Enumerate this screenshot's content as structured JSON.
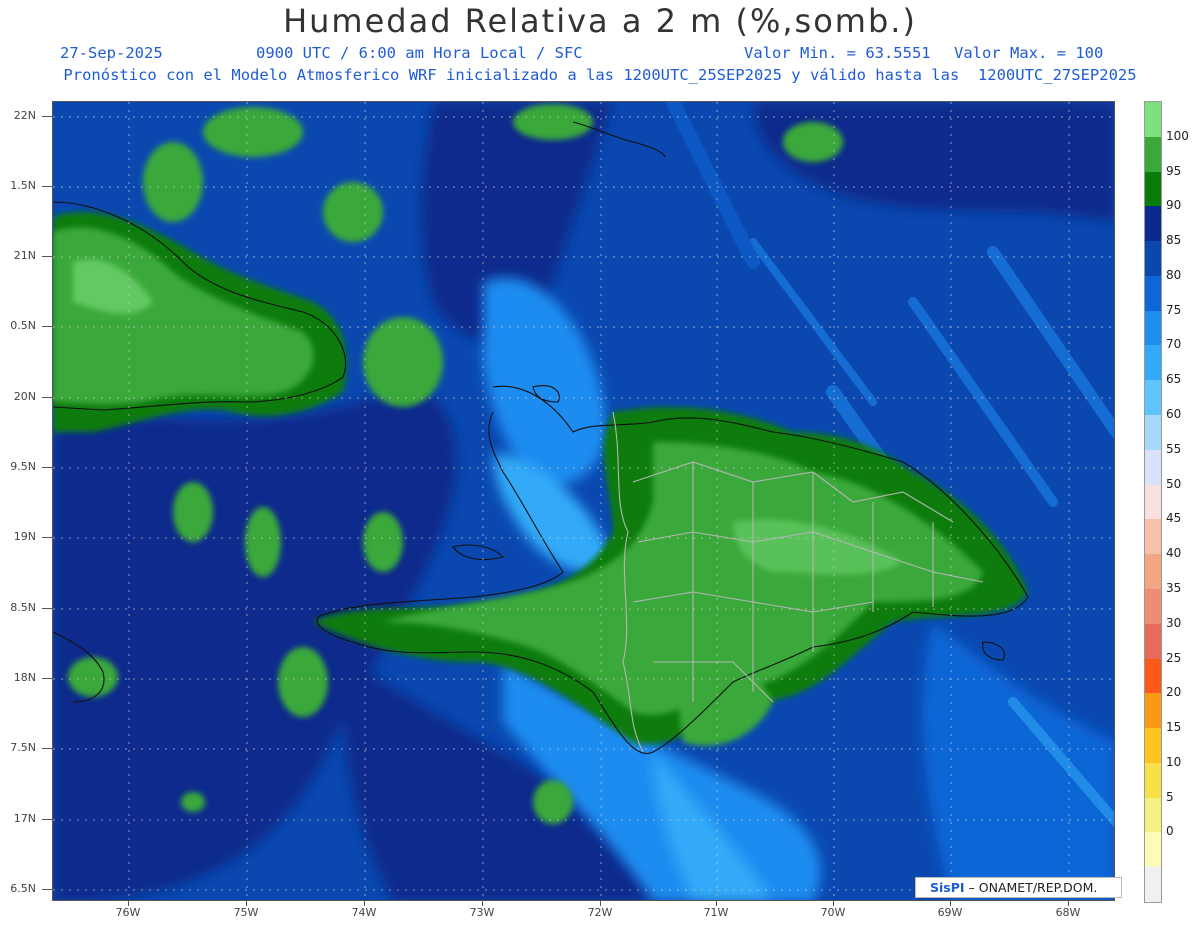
{
  "header": {
    "title": "Humedad Relativa a 2 m (%,somb.)",
    "date": "27-Sep-2025",
    "time_info": "0900 UTC / 6:00 am Hora Local / SFC",
    "min_value": "Valor Min. = 63.5551",
    "max_value": "Valor Max. = 100",
    "description": "Pronóstico con el Modelo Atmosferico WRF inicializado a las 1200UTC_25SEP2025 y válido hasta las  1200UTC_27SEP2025"
  },
  "axes": {
    "y_labels": [
      "22N",
      "1.5N",
      "21N",
      "0.5N",
      "20N",
      "9.5N",
      "19N",
      "8.5N",
      "18N",
      "7.5N",
      "17N",
      "6.5N"
    ],
    "x_labels": [
      "76W",
      "75W",
      "74W",
      "73W",
      "72W",
      "71W",
      "70W",
      "69W",
      "68W"
    ]
  },
  "colorbar": {
    "labels": [
      "100",
      "95",
      "90",
      "85",
      "80",
      "75",
      "70",
      "65",
      "60",
      "55",
      "50",
      "45",
      "40",
      "35",
      "30",
      "25",
      "20",
      "15",
      "10",
      "5",
      "0"
    ],
    "colors": [
      "#7ee07e",
      "#3aa83a",
      "#0a7c0a",
      "#0a2a8c",
      "#0a48b0",
      "#0f66d6",
      "#1f8cf0",
      "#33aaf8",
      "#5ec4fb",
      "#a6d8fa",
      "#d8e2fa",
      "#fae0e0",
      "#f7c0a8",
      "#f2a683",
      "#ee8c74",
      "#e86a5a",
      "#fb5a1a",
      "#fa9a14",
      "#fcc420",
      "#f8e048",
      "#f6f282",
      "#fcfcb8",
      "#f0f0f0"
    ]
  },
  "credit": {
    "logo": "SisPI",
    "text": "– ONAMET/REP.DOM."
  },
  "colors": {
    "header_text": "#1f5bd6",
    "sea_dark": "#0a2a8c",
    "sea": "#0a48b0",
    "land_green": "#3aa83a"
  }
}
